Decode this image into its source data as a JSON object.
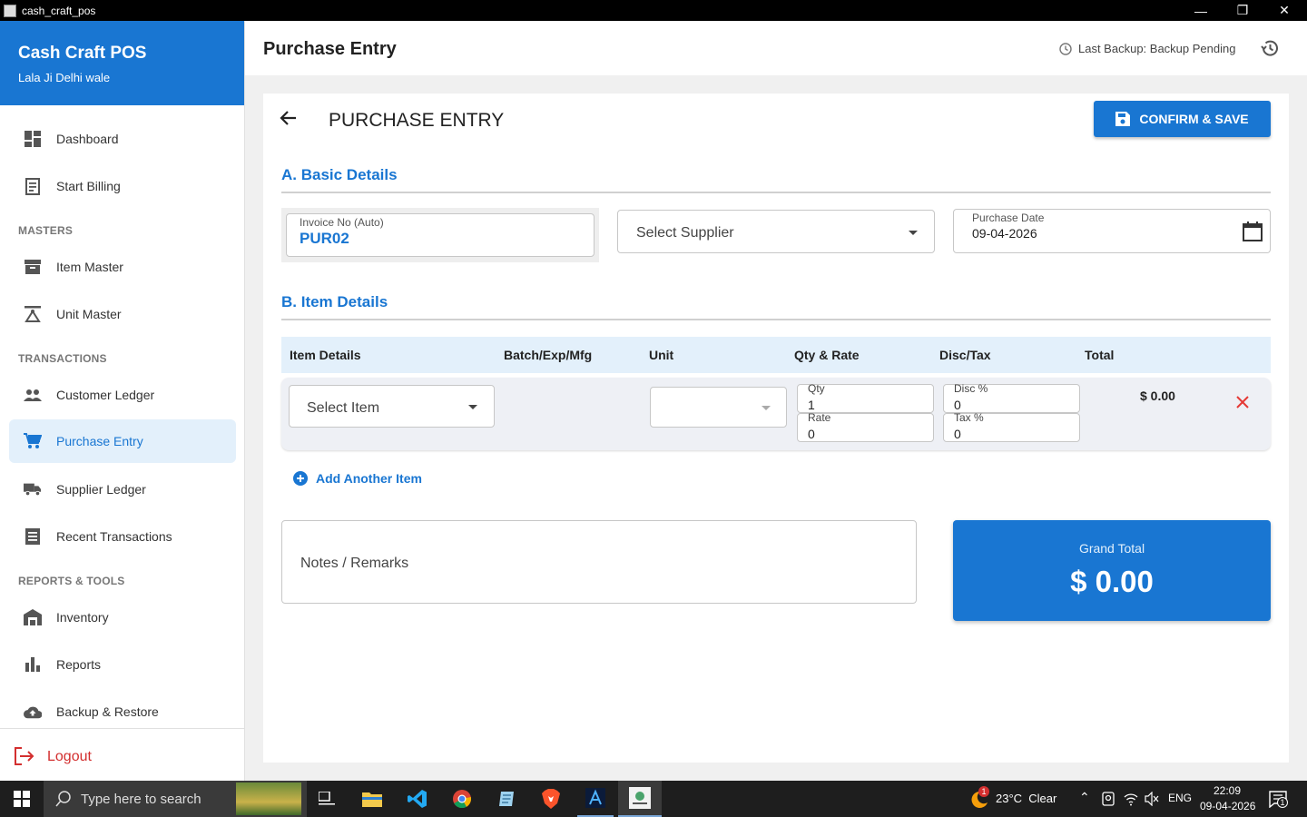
{
  "window": {
    "title": "cash_craft_pos",
    "minimize": "—",
    "maximize": "❐",
    "close": "✕"
  },
  "brand": {
    "name": "Cash Craft POS",
    "subtitle": "Lala Ji Delhi wale"
  },
  "sidebar": {
    "items": [
      {
        "label": "Dashboard",
        "icon": "dashboard-icon"
      },
      {
        "label": "Start Billing",
        "icon": "receipt-icon"
      },
      {
        "section": "MASTERS"
      },
      {
        "label": "Item Master",
        "icon": "archive-icon"
      },
      {
        "label": "Unit Master",
        "icon": "scale-icon"
      },
      {
        "section": "TRANSACTIONS"
      },
      {
        "label": "Customer Ledger",
        "icon": "people-icon"
      },
      {
        "label": "Purchase Entry",
        "icon": "cart-icon",
        "active": true
      },
      {
        "label": "Supplier Ledger",
        "icon": "truck-icon"
      },
      {
        "label": "Recent Transactions",
        "icon": "list-icon"
      },
      {
        "section": "REPORTS & TOOLS"
      },
      {
        "label": "Inventory",
        "icon": "warehouse-icon"
      },
      {
        "label": "Reports",
        "icon": "bar-chart-icon"
      },
      {
        "label": "Backup & Restore",
        "icon": "cloud-upload-icon"
      }
    ],
    "logout": "Logout"
  },
  "header": {
    "title": "Purchase Entry",
    "backup_text": "Last Backup: Backup Pending"
  },
  "main": {
    "title": "PURCHASE ENTRY",
    "save_label": "CONFIRM & SAVE",
    "section_a": "A. Basic Details",
    "section_b": "B. Item Details",
    "invoice": {
      "label": "Invoice No (Auto)",
      "value": "PUR02"
    },
    "supplier": {
      "placeholder": "Select Supplier"
    },
    "purchase_date": {
      "label": "Purchase Date",
      "value": "09-04-2026"
    },
    "table": {
      "columns": [
        "Item Details",
        "Batch/Exp/Mfg",
        "Unit",
        "Qty & Rate",
        "Disc/Tax",
        "Total"
      ],
      "rows": [
        {
          "item_placeholder": "Select Item",
          "unit": "",
          "qty_label": "Qty",
          "qty": "1",
          "rate_label": "Rate",
          "rate": "0",
          "disc_label": "Disc %",
          "disc": "0",
          "tax_label": "Tax %",
          "tax": "0",
          "total": "$ 0.00"
        }
      ]
    },
    "add_item": "Add Another Item",
    "notes_placeholder": "Notes / Remarks",
    "grand_total": {
      "label": "Grand Total",
      "value": "$ 0.00"
    }
  },
  "taskbar": {
    "search_placeholder": "Type here to search",
    "weather": "23°C  Clear",
    "weather_badge": "1",
    "lang": "ENG",
    "time": "22:09",
    "date": "09-04-2026",
    "notif_count": "1"
  },
  "colors": {
    "accent": "#1976d2",
    "active_bg": "#e3f0fb",
    "danger": "#d32f2f"
  }
}
